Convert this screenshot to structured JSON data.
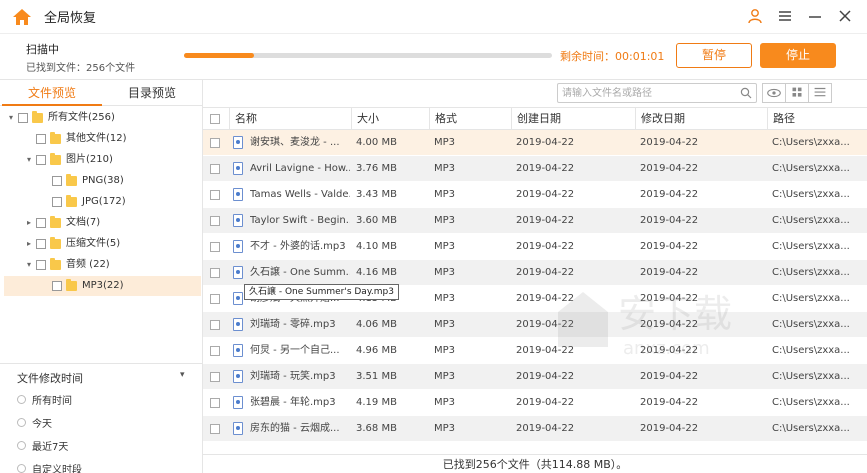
{
  "window": {
    "title": "全局恢复"
  },
  "scan": {
    "status": "扫描中",
    "found": "已找到文件：256个文件",
    "progress": 0.19,
    "remaining": "剩余时间：00:01:01",
    "pause_label": "暂停",
    "stop_label": "停止"
  },
  "tabs": [
    "文件预览",
    "目录预览"
  ],
  "tree": [
    {
      "label": "所有文件(256)",
      "level": 0,
      "caret": "▾"
    },
    {
      "label": "其他文件(12)",
      "level": 1,
      "caret": ""
    },
    {
      "label": "图片(210)",
      "level": 1,
      "caret": "▾"
    },
    {
      "label": "PNG(38)",
      "level": 2,
      "caret": ""
    },
    {
      "label": "JPG(172)",
      "level": 2,
      "caret": ""
    },
    {
      "label": "文档(7)",
      "level": 1,
      "caret": "▸"
    },
    {
      "label": "压缩文件(5)",
      "level": 1,
      "caret": "▸"
    },
    {
      "label": "音频 (22)",
      "level": 1,
      "caret": "▾"
    },
    {
      "label": "MP3(22)",
      "level": 2,
      "caret": "",
      "selected": true
    }
  ],
  "filter": {
    "title": "文件修改时间",
    "options": [
      "所有时间",
      "今天",
      "最近7天",
      "自定义时段"
    ]
  },
  "search": {
    "placeholder": "请输入文件名或路径"
  },
  "columns": [
    "名称",
    "大小",
    "格式",
    "创建日期",
    "修改日期",
    "路径"
  ],
  "rows": [
    {
      "name": "谢安琪、麦浚龙 - ...",
      "size": "4.00 MB",
      "format": "MP3",
      "created": "2019-04-22",
      "modified": "2019-04-22",
      "path": "C:\\Users\\zxxa..."
    },
    {
      "name": "Avril Lavigne - How...",
      "size": "3.76 MB",
      "format": "MP3",
      "created": "2019-04-22",
      "modified": "2019-04-22",
      "path": "C:\\Users\\zxxa..."
    },
    {
      "name": "Tamas Wells - Valde...",
      "size": "3.43 MB",
      "format": "MP3",
      "created": "2019-04-22",
      "modified": "2019-04-22",
      "path": "C:\\Users\\zxxa..."
    },
    {
      "name": "Taylor Swift - Begin...",
      "size": "3.60 MB",
      "format": "MP3",
      "created": "2019-04-22",
      "modified": "2019-04-22",
      "path": "C:\\Users\\zxxa..."
    },
    {
      "name": "不才 - 外婆的话.mp3",
      "size": "4.10 MB",
      "format": "MP3",
      "created": "2019-04-22",
      "modified": "2019-04-22",
      "path": "C:\\Users\\zxxa..."
    },
    {
      "name": "久石譲 - One Summ...",
      "size": "4.16 MB",
      "format": "MP3",
      "created": "2019-04-22",
      "modified": "2019-04-22",
      "path": "C:\\Users\\zxxa..."
    },
    {
      "name": "胡彦斌 - 天煞开始...",
      "size": "4.15 MB",
      "format": "MP3",
      "created": "2019-04-22",
      "modified": "2019-04-22",
      "path": "C:\\Users\\zxxa..."
    },
    {
      "name": "刘瑞琦 - 零碎.mp3",
      "size": "4.06 MB",
      "format": "MP3",
      "created": "2019-04-22",
      "modified": "2019-04-22",
      "path": "C:\\Users\\zxxa..."
    },
    {
      "name": "何炅 - 另一个自己...",
      "size": "4.96 MB",
      "format": "MP3",
      "created": "2019-04-22",
      "modified": "2019-04-22",
      "path": "C:\\Users\\zxxa..."
    },
    {
      "name": "刘瑞琦 - 玩笑.mp3",
      "size": "3.51 MB",
      "format": "MP3",
      "created": "2019-04-22",
      "modified": "2019-04-22",
      "path": "C:\\Users\\zxxa..."
    },
    {
      "name": "张碧晨 - 年轮.mp3",
      "size": "4.19 MB",
      "format": "MP3",
      "created": "2019-04-22",
      "modified": "2019-04-22",
      "path": "C:\\Users\\zxxa..."
    },
    {
      "name": "房东的猫 - 云烟成...",
      "size": "3.68 MB",
      "format": "MP3",
      "created": "2019-04-22",
      "modified": "2019-04-22",
      "path": "C:\\Users\\zxxa..."
    }
  ],
  "tooltip": "久石譲 - One Summer's Day.mp3",
  "status_bar": "已找到256个文件（共114.88 MB）。",
  "colors": {
    "accent": "#f88a1d",
    "accent_text": "#f07b14",
    "selected_bg": "#fdecd9",
    "stripe": "#f1f1f1"
  }
}
